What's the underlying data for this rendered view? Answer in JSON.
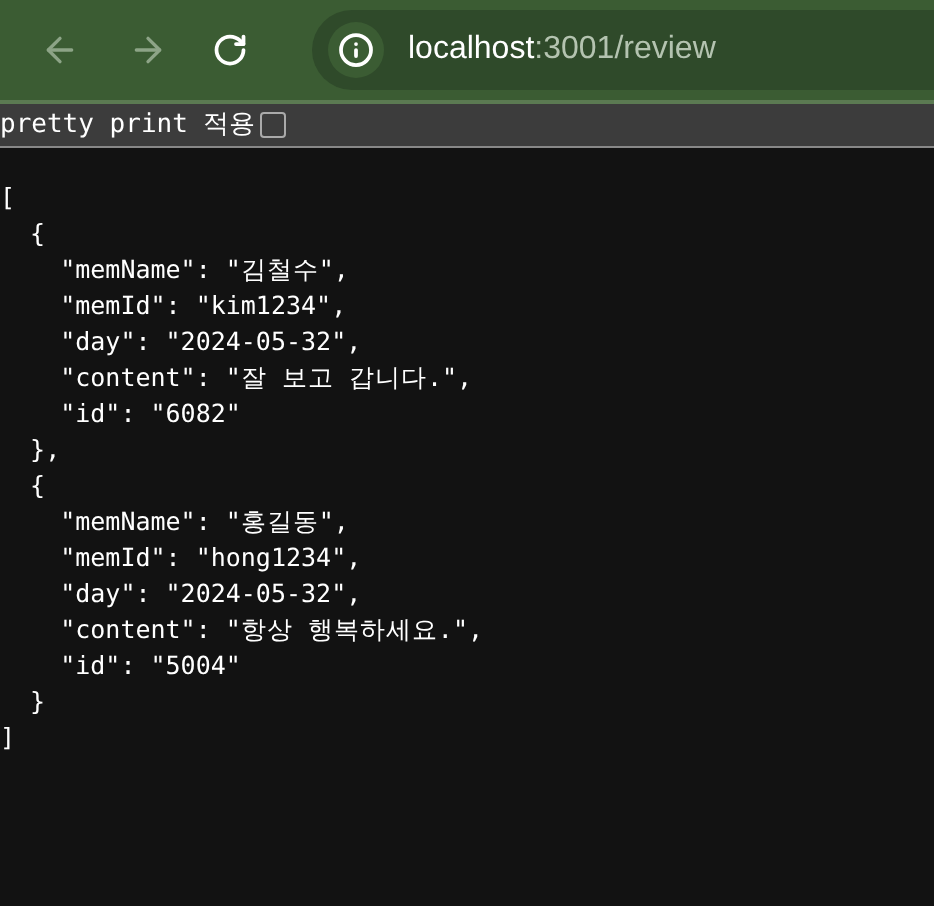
{
  "toolbar": {
    "url_host": "localhost",
    "url_path": ":3001/review"
  },
  "pretty_print": {
    "label": "pretty print 적용",
    "checked": false
  },
  "json_lines": [
    "[",
    "  {",
    "    \"memName\": \"김철수\",",
    "    \"memId\": \"kim1234\",",
    "    \"day\": \"2024-05-32\",",
    "    \"content\": \"잘 보고 갑니다.\",",
    "    \"id\": \"6082\"",
    "  },",
    "  {",
    "    \"memName\": \"홍길동\",",
    "    \"memId\": \"hong1234\",",
    "    \"day\": \"2024-05-32\",",
    "    \"content\": \"항상 행복하세요.\",",
    "    \"id\": \"5004\"",
    "  }",
    "]"
  ]
}
